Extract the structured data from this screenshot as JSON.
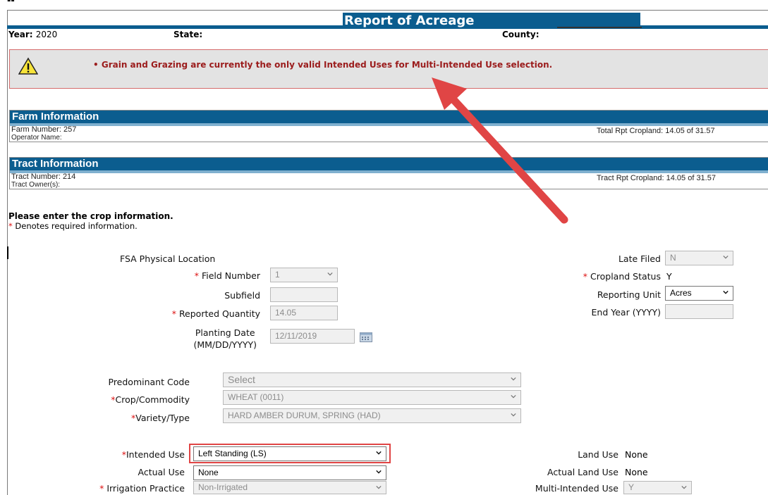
{
  "header": {
    "corner_mark": "--",
    "title": "Report of Acreage",
    "year_label": "Year:",
    "year_value": "2020",
    "state_label": "State:",
    "county_label": "County:"
  },
  "alert": {
    "message": "•  Grain and Grazing are currently the only valid Intended Uses for Multi-Intended Use selection.",
    "icon": "warning-icon"
  },
  "farm_info": {
    "heading": "Farm Information",
    "farm_number": "Farm Number: 257",
    "operator_name": "Operator Name:",
    "total_cropland": "Total Rpt Cropland: 14.05 of 31.57"
  },
  "tract_info": {
    "heading": "Tract Information",
    "tract_number": "Tract Number: 214",
    "tract_owner": "Tract Owner(s):",
    "tract_cropland": "Tract Rpt Cropland: 14.05 of 31.57"
  },
  "instructions": {
    "title": "Please enter the crop information.",
    "required_note": "Denotes required information.",
    "asterisk": "*"
  },
  "form": {
    "fsa_location_label": "FSA Physical Location",
    "field_number_label": "Field Number",
    "field_number_value": "1",
    "subfield_label": "Subfield",
    "subfield_value": "",
    "reported_qty_label": "Reported Quantity",
    "reported_qty_value": "14.05",
    "planting_date_label_1": "Planting Date",
    "planting_date_label_2": "(MM/DD/YYYY)",
    "planting_date_value": "12/11/2019",
    "late_filed_label": "Late Filed",
    "late_filed_value": "N",
    "cropland_status_label": "Cropland Status",
    "cropland_status_value": "Y",
    "reporting_unit_label": "Reporting Unit",
    "reporting_unit_value": "Acres",
    "end_year_label": "End Year (YYYY)",
    "end_year_value": "",
    "predominant_code_label": "Predominant Code",
    "predominant_code_value": "Select",
    "crop_label": "Crop/Commodity",
    "crop_value": "WHEAT (0011)",
    "variety_label": "Variety/Type",
    "variety_value": "HARD AMBER DURUM, SPRING (HAD)",
    "intended_use_label": "Intended Use",
    "intended_use_value": "Left Standing (LS)",
    "actual_use_label": "Actual Use",
    "actual_use_value": "None",
    "irrigation_label": "Irrigation Practice",
    "irrigation_value": "Non-Irrigated",
    "land_use_label": "Land Use",
    "land_use_value": "None",
    "actual_land_use_label": "Actual Land Use",
    "actual_land_use_value": "None",
    "multi_intended_label": "Multi-Intended Use",
    "multi_intended_value": "Y"
  },
  "colors": {
    "header_blue": "#0b5d8f",
    "alert_text": "#9b1c1c",
    "annotation_red": "#e04545"
  }
}
